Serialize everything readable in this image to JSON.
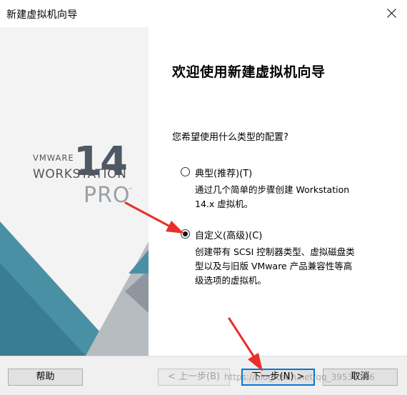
{
  "window": {
    "title": "新建虚拟机向导",
    "close_icon": "close-icon"
  },
  "logo": {
    "vmware": "VMWARE",
    "version": "14",
    "product": "WORKSTATION",
    "edition": "PRO",
    "tm": "™"
  },
  "main": {
    "heading": "欢迎使用新建虚拟机向导",
    "question": "您希望使用什么类型的配置?",
    "options": [
      {
        "label": "典型(推荐)(T)",
        "selected": false,
        "desc": [
          "通过几个简单的步骤创建 Workstation",
          "14.x 虚拟机。"
        ]
      },
      {
        "label": "自定义(高级)(C)",
        "selected": true,
        "desc": [
          "创建带有 SCSI 控制器类型、虚拟磁盘类",
          "型以及与旧版 VMware 产品兼容性等高",
          "级选项的虚拟机。"
        ]
      }
    ]
  },
  "buttons": {
    "help": "帮助",
    "back": "< 上一步(B)",
    "next": "下一步(N) >",
    "cancel": "取消"
  },
  "watermark": "https://blog.csdn.net/qq_39536166",
  "colors": {
    "accent": "#0078d7",
    "arrow": "#e8302a",
    "triangle_teal": "#4a90a4"
  }
}
